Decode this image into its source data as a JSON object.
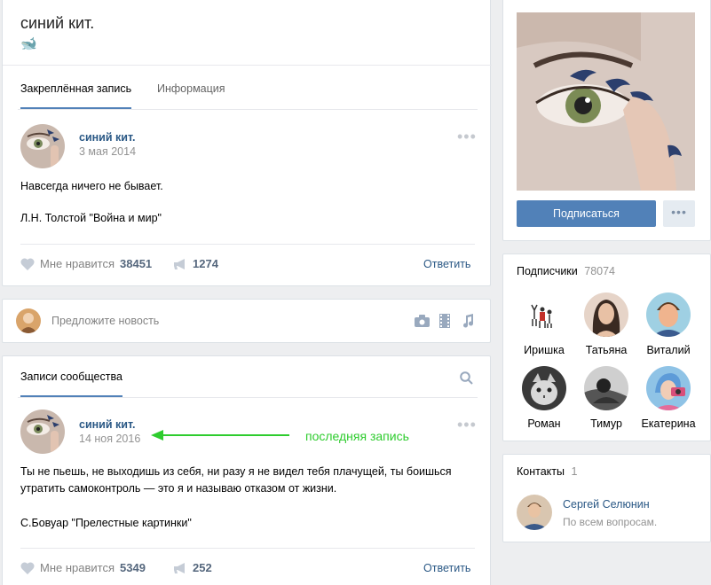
{
  "group": {
    "name": "синий кит.",
    "emoji": "🐋"
  },
  "tabs": {
    "pinned": "Закреплённая запись",
    "info": "Информация"
  },
  "pinned_post": {
    "author": "синий кит.",
    "date": "3 мая 2014",
    "text1": "Навсегда ничего не бывает.",
    "text2": "Л.Н. Толстой \"Война и мир\"",
    "likes_label": "Мне нравится",
    "likes": "38451",
    "shares": "1274",
    "reply": "Ответить"
  },
  "suggest": {
    "placeholder": "Предложите новость"
  },
  "wall": {
    "tab": "Записи сообщества"
  },
  "post": {
    "author": "синий кит.",
    "date": "14 ноя 2016",
    "annotation": "последняя запись",
    "text1": "Ты не пьешь, не выходишь из себя, ни разу я не видел тебя плачущей, ты боишься",
    "text2": "утратить самоконтроль — это я и называю отказом от жизни.",
    "text3": "С.Бовуар \"Прелестные картинки\"",
    "likes_label": "Мне нравится",
    "likes": "5349",
    "shares": "252",
    "reply": "Ответить"
  },
  "sidebar": {
    "subscribe": "Подписаться",
    "subscribers_title": "Подписчики",
    "subscribers_count": "78074",
    "subscribers": [
      {
        "name": "Иришка"
      },
      {
        "name": "Татьяна"
      },
      {
        "name": "Виталий"
      },
      {
        "name": "Роман"
      },
      {
        "name": "Тимур"
      },
      {
        "name": "Екатерина"
      }
    ],
    "contacts_title": "Контакты",
    "contacts_count": "1",
    "contact": {
      "name": "Сергей Селюнин",
      "role": "По всем вопросам."
    }
  },
  "colors": {
    "accent": "#5181b8",
    "link": "#2a5885",
    "annotation": "#2ecc2e"
  }
}
